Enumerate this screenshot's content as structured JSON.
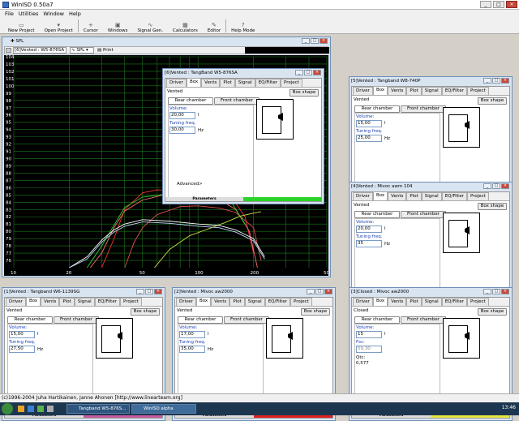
{
  "app": {
    "title": "WinISD 0.50a7"
  },
  "menu": [
    "File",
    "Utilities",
    "Window",
    "Help"
  ],
  "toolbar": [
    {
      "label": "New Project",
      "icon": "new-icon"
    },
    {
      "label": "Open Project",
      "icon": "open-icon"
    },
    {
      "label": "Cursor",
      "icon": "cursor-icon"
    },
    {
      "label": "Windows",
      "icon": "windows-icon"
    },
    {
      "label": "Signal Gen.",
      "icon": "signal-icon"
    },
    {
      "label": "Calculators",
      "icon": "calc-icon"
    },
    {
      "label": "Editor",
      "icon": "editor-icon"
    },
    {
      "label": "Help Mode",
      "icon": "help-icon"
    }
  ],
  "spl": {
    "title": "SPL",
    "project": "[6]Vented : W5-876SA",
    "graph": "SPL",
    "print": "Print"
  },
  "chart_data": {
    "type": "line",
    "title": "",
    "xlabel": "",
    "ylabel": "",
    "xlim": [
      10,
      500
    ],
    "ylim": [
      75,
      104
    ],
    "xticks": [
      10,
      20,
      50,
      100,
      200,
      500
    ],
    "yticks": [
      76,
      77,
      78,
      79,
      80,
      81,
      82,
      83,
      84,
      85,
      86,
      87,
      88,
      89,
      90,
      91,
      92,
      93,
      94,
      95,
      96,
      97,
      98,
      99,
      100,
      101,
      102,
      103,
      104
    ],
    "series": [
      {
        "color": "#ff3030",
        "x": [
          30,
          35,
          40,
          50,
          60,
          80,
          100,
          120,
          150,
          180,
          200
        ],
        "y": [
          75,
          79,
          83,
          85.3,
          85.7,
          85.6,
          85.5,
          85.3,
          84.9,
          82,
          77
        ]
      },
      {
        "color": "#ff6f6f",
        "x": [
          26,
          30,
          35,
          40,
          50,
          70,
          100,
          130,
          160,
          190,
          210
        ],
        "y": [
          75,
          77,
          80.5,
          82.8,
          84.3,
          85.2,
          84.9,
          84.4,
          83,
          80,
          75
        ]
      },
      {
        "color": "#e05050",
        "x": [
          40,
          45,
          50,
          60,
          80,
          100,
          130,
          160,
          200,
          220
        ],
        "y": [
          75,
          78.5,
          80.5,
          82.3,
          83.4,
          83.5,
          83.2,
          82.6,
          80.5,
          76
        ]
      },
      {
        "color": "#30d030",
        "x": [
          25,
          30,
          40,
          50,
          70,
          100,
          130,
          150,
          180
        ],
        "y": [
          75,
          78,
          83.3,
          84.7,
          85.2,
          85.3,
          84.8,
          84.2,
          81
        ]
      },
      {
        "color": "#c8e040",
        "x": [
          58,
          70,
          90,
          110,
          140,
          170,
          200,
          220
        ],
        "y": [
          75,
          77.5,
          79.4,
          80.2,
          81.2,
          82.1,
          82.5,
          82.7
        ]
      },
      {
        "color": "#ffffff",
        "x": [
          20,
          25,
          30,
          35,
          40,
          50,
          70,
          100,
          130,
          160,
          200,
          230
        ],
        "y": [
          75,
          76.5,
          78.8,
          80.2,
          81,
          81.6,
          81.4,
          81,
          80.8,
          80.2,
          79,
          76.5
        ]
      },
      {
        "color": "#c0d8ff",
        "x": [
          20,
          25,
          30,
          35,
          40,
          50,
          70,
          100,
          130,
          160,
          200,
          230
        ],
        "y": [
          75,
          76.2,
          78.5,
          79.9,
          80.7,
          81.3,
          81.1,
          80.7,
          80.5,
          79.9,
          78.7,
          76.2
        ]
      }
    ]
  },
  "boxwins": [
    {
      "id": "w6",
      "title": "[6]Vented : TangBand W5-876SA",
      "type": "Vented",
      "vol": "20,00",
      "p2label": "Tuning freq.",
      "p2": "30,00",
      "unit": "Hz",
      "color": "#2ad42a"
    },
    {
      "id": "w5",
      "title": "[5]Vented : Tangband W8-740P",
      "type": "Vented",
      "vol": "15,00",
      "p2label": "Tuning freq.",
      "p2": "25,00",
      "unit": "Hz",
      "color": "#7fe5f0"
    },
    {
      "id": "w4",
      "title": "[4]Vented : Mivoc awm 104",
      "type": "Vented",
      "vol": "20,00",
      "p2label": "Tuning freq.",
      "p2": "35",
      "unit": "Hz",
      "color": "#f08a3a"
    },
    {
      "id": "w1",
      "title": "[1]Vented : Tangband W6-1139SG",
      "type": "Vented",
      "vol": "15,00",
      "p2label": "Tuning freq.",
      "p2": "27,50",
      "unit": "Hz",
      "color": "#c85aa0"
    },
    {
      "id": "w2",
      "title": "[2]Vented : Mivoc aw2000",
      "type": "Vented",
      "vol": "17,00",
      "p2label": "Tuning freq.",
      "p2": "35,00",
      "unit": "Hz",
      "color": "#e02020"
    },
    {
      "id": "w3",
      "title": "[3]Closed : Mivoc aw2000",
      "type": "Closed",
      "vol": "15",
      "p2label": "Fsc:",
      "p2": "59,30",
      "unit": "",
      "qtc_label": "Qtc:",
      "qtc": "0,577",
      "color": "#e8e840"
    }
  ],
  "tabs": [
    "Driver",
    "Box",
    "Vents",
    "Plot",
    "Signal",
    "EQ/Filter",
    "Project"
  ],
  "labels": {
    "box_shape": "Box shape",
    "rear": "Rear chamber",
    "front": "Front chamber",
    "volume": "Volume:",
    "advanced": "Advanced>",
    "parameters": "Parameters",
    "l": "l"
  },
  "statusbar": "(c)1996-2004 Juha Hartikainen, Janne Ahonen [http://www.linearteam.org]",
  "taskbar": {
    "items": [
      "Tangband W5-876S...",
      "WinISD alpha"
    ],
    "clock": "13:46"
  }
}
